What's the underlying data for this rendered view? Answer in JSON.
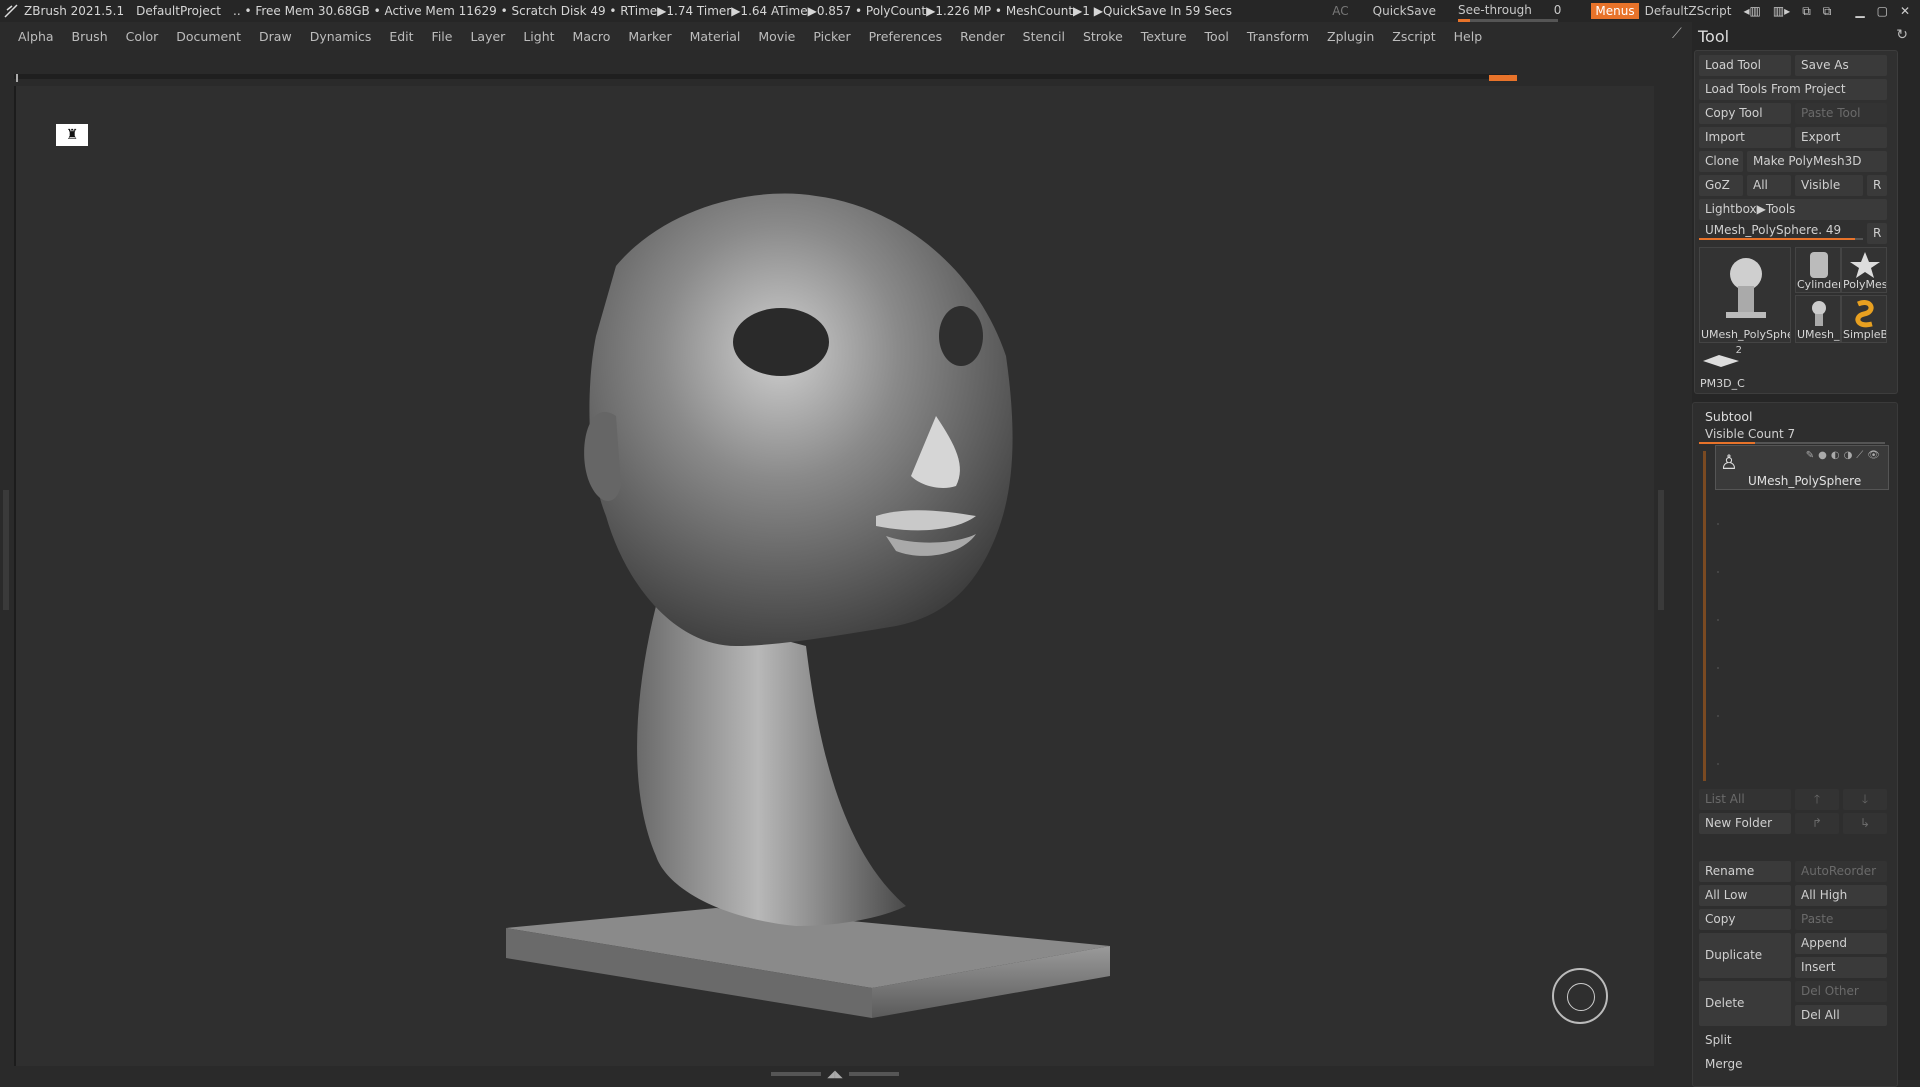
{
  "titlebar": {
    "app": "ZBrush 2021.5.1",
    "project": "DefaultProject",
    "stats": ".. • Free Mem 30.68GB • Active Mem 11629 • Scratch Disk 49 • RTime▶1.74 Timer▶1.64 ATime▶0.857 • PolyCount▶1.226 MP • MeshCount▶1 ▶QuickSave In 59 Secs",
    "ac": "AC",
    "quicksave": "QuickSave",
    "see_through_label": "See-through",
    "see_through_value": "0",
    "menus": "Menus",
    "zscript": "DefaultZScript",
    "accent": "#e8732a"
  },
  "menubar": [
    "Alpha",
    "Brush",
    "Color",
    "Document",
    "Draw",
    "Dynamics",
    "Edit",
    "File",
    "Layer",
    "Light",
    "Macro",
    "Marker",
    "Material",
    "Movie",
    "Picker",
    "Preferences",
    "Render",
    "Stencil",
    "Stroke",
    "Texture",
    "Tool",
    "Transform",
    "Zplugin",
    "Zscript",
    "Help"
  ],
  "panel": {
    "title": "Tool",
    "load_tool": "Load Tool",
    "save_as": "Save As",
    "load_from_project": "Load Tools From Project",
    "copy_tool": "Copy Tool",
    "paste_tool": "Paste Tool",
    "import": "Import",
    "export": "Export",
    "clone": "Clone",
    "make_polymesh": "Make PolyMesh3D",
    "goz": "GoZ",
    "all": "All",
    "visible": "Visible",
    "r": "R",
    "lightbox_tools": "Lightbox▶Tools",
    "current_tool": "UMesh_PolySphere. 49",
    "current_tool_fill": 0.95,
    "thumbs": [
      {
        "cap": "UMesh_PolySphe"
      },
      {
        "cap": "Cylinder"
      },
      {
        "cap": "PolyMes"
      },
      {
        "cap": "UMesh_"
      },
      {
        "cap": "SimpleB"
      },
      {
        "cap": "PM3D_C",
        "num": "2"
      }
    ],
    "subtool": {
      "title": "Subtool",
      "visible_count": "Visible Count 7",
      "visible_fill": 0.3,
      "item_name": "UMesh_PolySphere",
      "list_all": "List All",
      "new_folder": "New Folder",
      "rename": "Rename",
      "autoreorder": "AutoReorder",
      "all_low": "All Low",
      "all_high": "All High",
      "copy": "Copy",
      "paste": "Paste",
      "duplicate": "Duplicate",
      "append": "Append",
      "insert": "Insert",
      "delete": "Delete",
      "del_other": "Del Other",
      "del_all": "Del All",
      "split": "Split",
      "merge": "Merge"
    }
  }
}
